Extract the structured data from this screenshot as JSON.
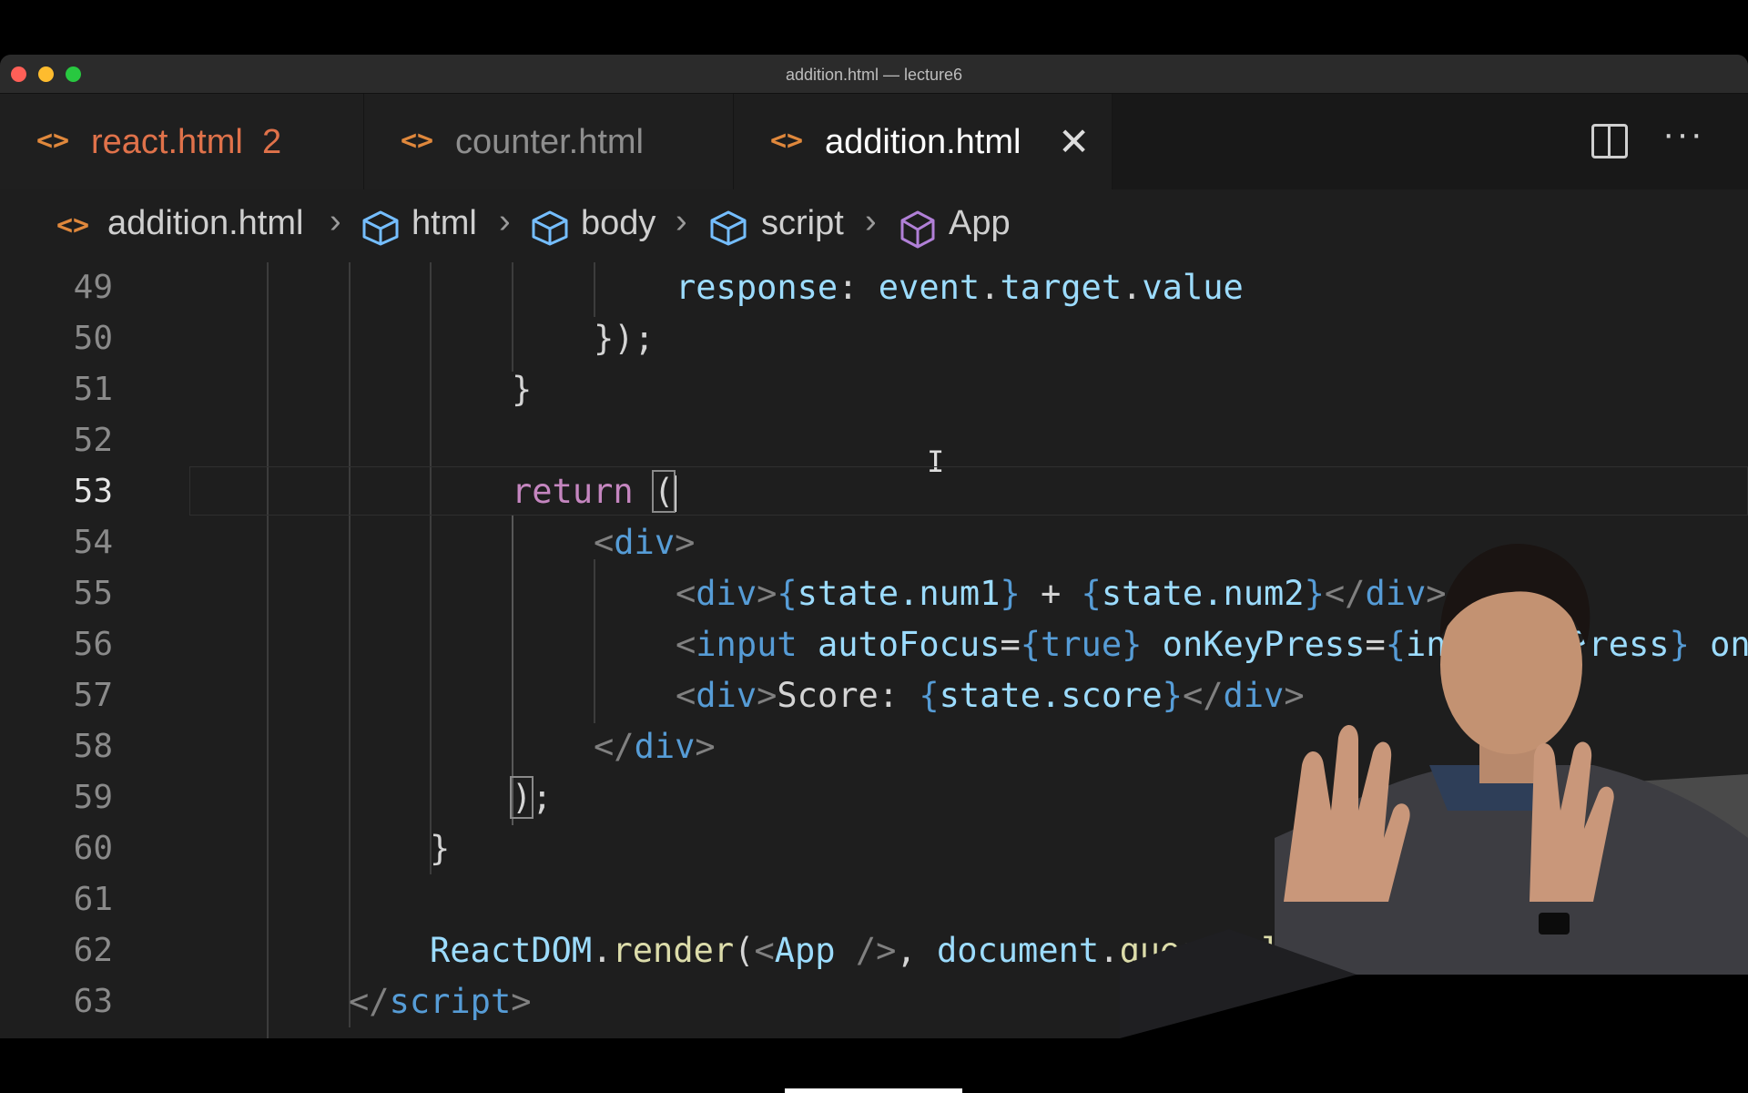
{
  "window": {
    "title": "addition.html — lecture6"
  },
  "tabs": [
    {
      "label": "react.html",
      "badge": "2",
      "icon": "html-file-icon",
      "state": "error"
    },
    {
      "label": "counter.html",
      "icon": "html-file-icon",
      "state": "normal"
    },
    {
      "label": "addition.html",
      "icon": "html-file-icon",
      "state": "active",
      "close": "✕"
    }
  ],
  "breadcrumb": {
    "file": "addition.html",
    "items": [
      "html",
      "body",
      "script",
      "App"
    ],
    "separator": "›"
  },
  "editor": {
    "current_line": 53,
    "lines": [
      {
        "num": "49",
        "tokens": [
          [
            "var",
            "response"
          ],
          [
            "txt",
            ": "
          ],
          [
            "var",
            "event"
          ],
          [
            "txt",
            "."
          ],
          [
            "var",
            "target"
          ],
          [
            "txt",
            "."
          ],
          [
            "var",
            "value"
          ]
        ]
      },
      {
        "num": "50",
        "tokens": [
          [
            "txt",
            "});"
          ]
        ]
      },
      {
        "num": "51",
        "tokens": [
          [
            "txt",
            "}"
          ]
        ]
      },
      {
        "num": "52",
        "tokens": []
      },
      {
        "num": "53",
        "tokens": [
          [
            "kw",
            "return"
          ],
          [
            "txt",
            " "
          ],
          [
            "box",
            "("
          ]
        ]
      },
      {
        "num": "54",
        "tokens": [
          [
            "punc",
            "<"
          ],
          [
            "tag",
            "div"
          ],
          [
            "punc",
            ">"
          ]
        ]
      },
      {
        "num": "55",
        "tokens": [
          [
            "punc",
            "<"
          ],
          [
            "tag",
            "div"
          ],
          [
            "punc",
            ">"
          ],
          [
            "brace",
            "{"
          ],
          [
            "var",
            "state.num1"
          ],
          [
            "brace",
            "}"
          ],
          [
            "txt",
            " + "
          ],
          [
            "brace",
            "{"
          ],
          [
            "var",
            "state.num2"
          ],
          [
            "brace",
            "}"
          ],
          [
            "punc",
            "</"
          ],
          [
            "tag",
            "div"
          ],
          [
            "punc",
            ">"
          ]
        ]
      },
      {
        "num": "56",
        "tokens": [
          [
            "punc",
            "<"
          ],
          [
            "tag",
            "input"
          ],
          [
            "txt",
            " "
          ],
          [
            "var",
            "autoFocus"
          ],
          [
            "txt",
            "="
          ],
          [
            "brace",
            "{"
          ],
          [
            "tag",
            "true"
          ],
          [
            "brace",
            "}"
          ],
          [
            "txt",
            " "
          ],
          [
            "var",
            "onKeyPress"
          ],
          [
            "txt",
            "="
          ],
          [
            "brace",
            "{"
          ],
          [
            "var",
            "inputKeyPress"
          ],
          [
            "brace",
            "}"
          ],
          [
            "txt",
            " "
          ],
          [
            "var",
            "onChange"
          ]
        ]
      },
      {
        "num": "57",
        "tokens": [
          [
            "punc",
            "<"
          ],
          [
            "tag",
            "div"
          ],
          [
            "punc",
            ">"
          ],
          [
            "txt",
            "Score: "
          ],
          [
            "brace",
            "{"
          ],
          [
            "var",
            "state.score"
          ],
          [
            "brace",
            "}"
          ],
          [
            "punc",
            "</"
          ],
          [
            "tag",
            "div"
          ],
          [
            "punc",
            ">"
          ]
        ]
      },
      {
        "num": "58",
        "tokens": [
          [
            "punc",
            "</"
          ],
          [
            "tag",
            "div"
          ],
          [
            "punc",
            ">"
          ]
        ]
      },
      {
        "num": "59",
        "tokens": [
          [
            "box",
            ")"
          ],
          [
            "txt",
            ";"
          ]
        ]
      },
      {
        "num": "60",
        "tokens": [
          [
            "txt",
            "}"
          ]
        ]
      },
      {
        "num": "61",
        "tokens": []
      },
      {
        "num": "62",
        "tokens": [
          [
            "var",
            "ReactDOM"
          ],
          [
            "txt",
            "."
          ],
          [
            "fn",
            "render"
          ],
          [
            "txt",
            "("
          ],
          [
            "punc",
            "<"
          ],
          [
            "var",
            "App"
          ],
          [
            "txt",
            " "
          ],
          [
            "punc",
            "/>"
          ],
          [
            "txt",
            ", "
          ],
          [
            "var",
            "document"
          ],
          [
            "txt",
            "."
          ],
          [
            "fn",
            "querySelector"
          ],
          [
            "txt",
            "("
          ]
        ]
      },
      {
        "num": "63",
        "tokens": [
          [
            "punc",
            "</"
          ],
          [
            "tag",
            "script"
          ],
          [
            "punc",
            ">"
          ]
        ]
      }
    ]
  },
  "colors": {
    "editor_bg": "#1e1e1e",
    "keyword": "#c586c0",
    "variable": "#9cdcfe",
    "tag": "#569cd6",
    "function": "#dcdcaa",
    "error_tab": "#e0724a",
    "file_icon": "#e0883c",
    "symbol_icon": "#75beff",
    "component_icon": "#b180d7"
  }
}
